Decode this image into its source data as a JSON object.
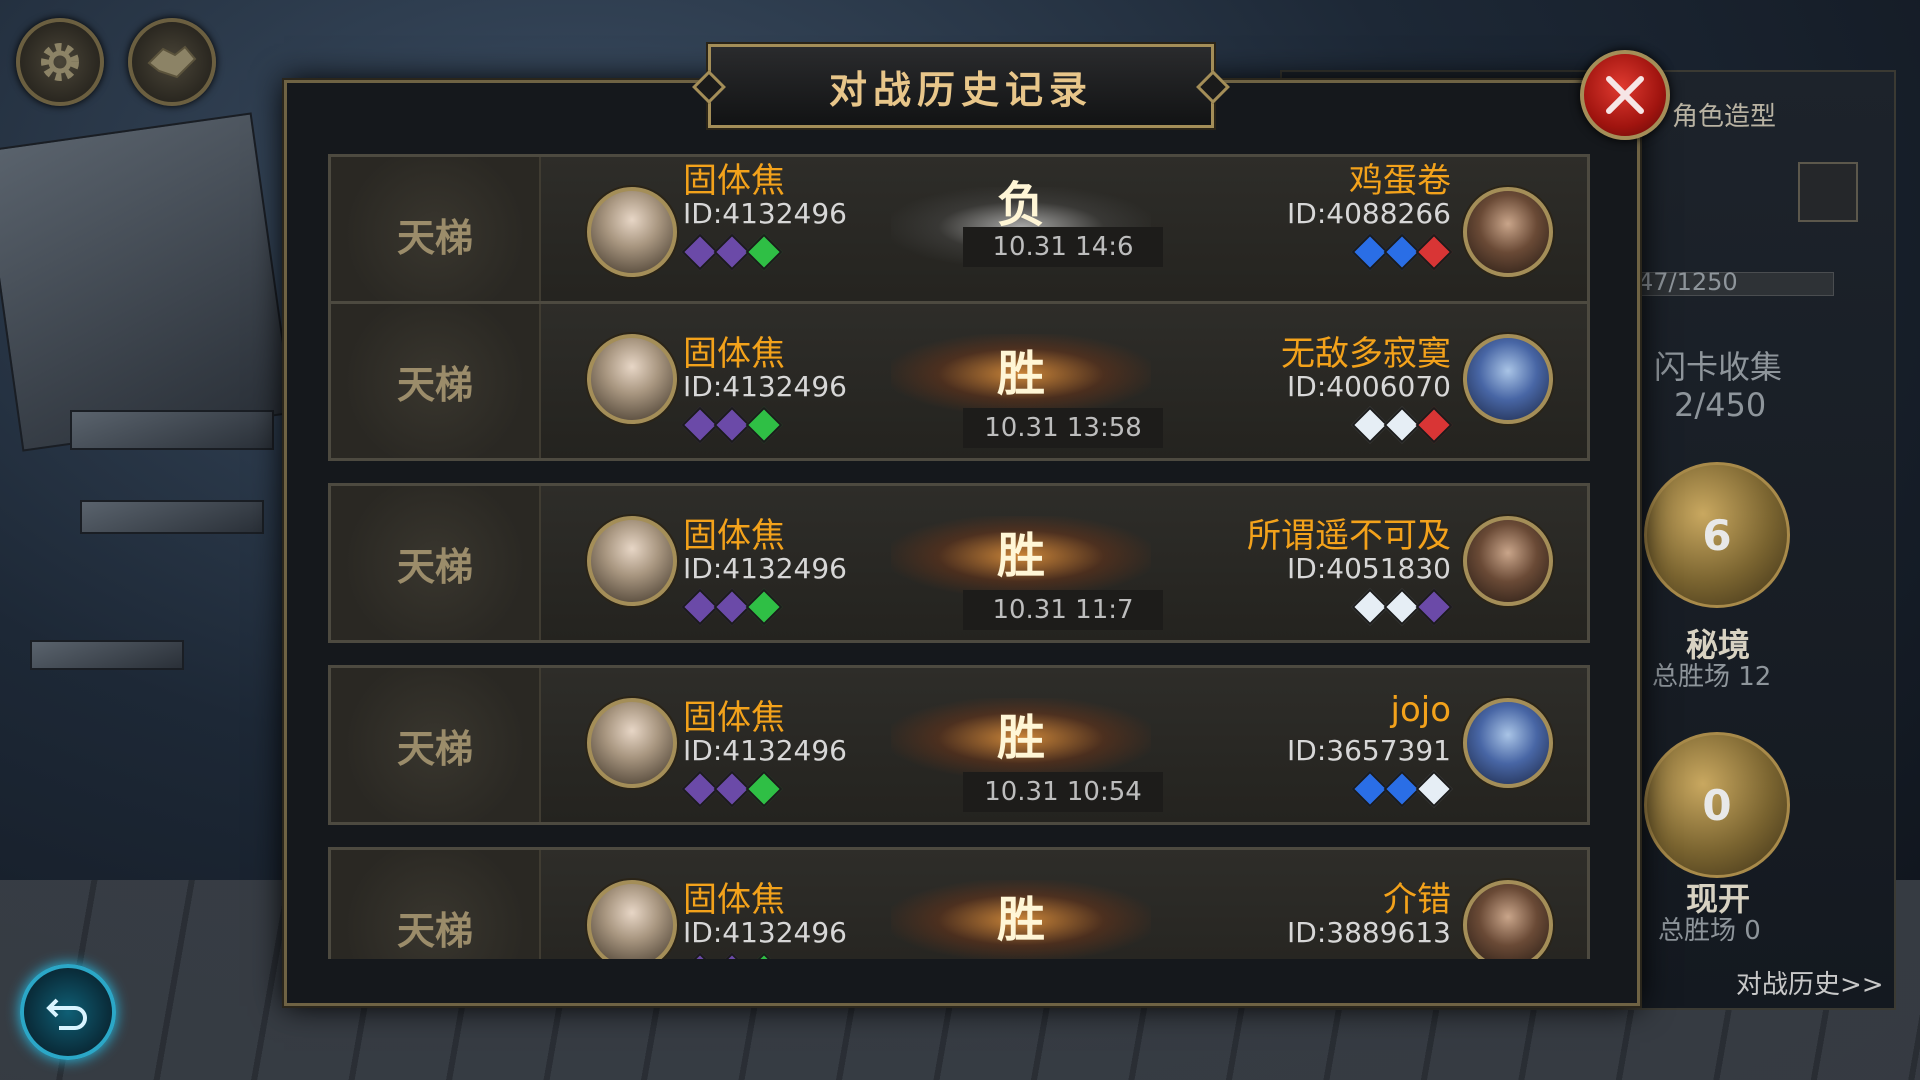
{
  "dialog": {
    "title": "对战历史记录"
  },
  "side_panel": {
    "tab_label": "角色造型",
    "progress_text": "47/1250",
    "flash_card_label": "闪卡收集",
    "flash_card_count": "2/450",
    "mode1": {
      "count": "6",
      "name": "秘境",
      "wins_label": "总胜场 12"
    },
    "mode2": {
      "count": "0",
      "name": "现开",
      "wins_label": "总胜场 0"
    },
    "history_link": "对战历史>>"
  },
  "gem_colors": {
    "purple": "#6b4aa8",
    "green": "#2fbf45",
    "blue": "#2a6ee6",
    "red": "#d93535",
    "white": "#e6eef5"
  },
  "matches": [
    {
      "mode": "天梯",
      "player_name": "固体焦",
      "player_id": "ID:4132496",
      "player_gems": [
        "purple",
        "purple",
        "green"
      ],
      "result": "负",
      "time": "10.31  14:6",
      "opponent_name": "鸡蛋卷",
      "opponent_id": "ID:4088266",
      "opponent_gems": [
        "blue",
        "blue",
        "red"
      ],
      "opponent_avatar": "male"
    },
    {
      "mode": "天梯",
      "player_name": "固体焦",
      "player_id": "ID:4132496",
      "player_gems": [
        "purple",
        "purple",
        "green"
      ],
      "result": "胜",
      "time": "10.31  13:58",
      "opponent_name": "无敌多寂寞",
      "opponent_id": "ID:4006070",
      "opponent_gems": [
        "white",
        "white",
        "red"
      ],
      "opponent_avatar": "blue"
    },
    {
      "mode": "天梯",
      "player_name": "固体焦",
      "player_id": "ID:4132496",
      "player_gems": [
        "purple",
        "purple",
        "green"
      ],
      "result": "胜",
      "time": "10.31  11:7",
      "opponent_name": "所谓遥不可及",
      "opponent_id": "ID:4051830",
      "opponent_gems": [
        "white",
        "white",
        "purple"
      ],
      "opponent_avatar": "male"
    },
    {
      "mode": "天梯",
      "player_name": "固体焦",
      "player_id": "ID:4132496",
      "player_gems": [
        "purple",
        "purple",
        "green"
      ],
      "result": "胜",
      "time": "10.31  10:54",
      "opponent_name": "jojo",
      "opponent_id": "ID:3657391",
      "opponent_gems": [
        "blue",
        "blue",
        "white"
      ],
      "opponent_avatar": "blue"
    },
    {
      "mode": "天梯",
      "player_name": "固体焦",
      "player_id": "ID:4132496",
      "player_gems": [
        "purple",
        "purple",
        "green"
      ],
      "result": "胜",
      "time": "",
      "opponent_name": "介错",
      "opponent_id": "ID:3889613",
      "opponent_gems": [],
      "opponent_avatar": "male"
    }
  ]
}
